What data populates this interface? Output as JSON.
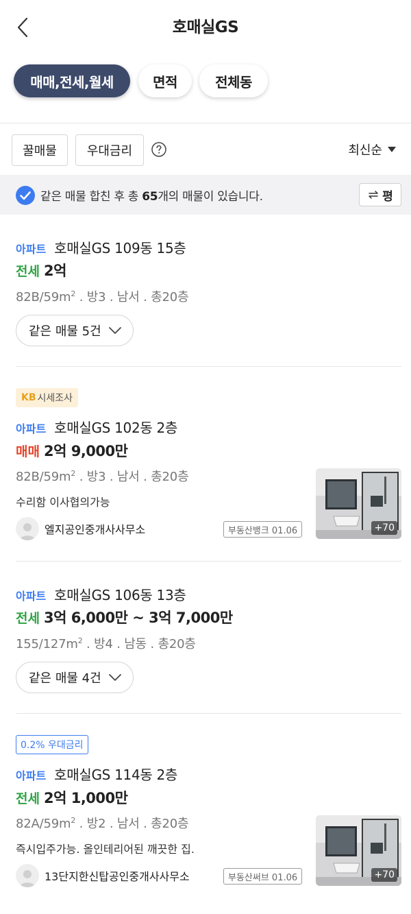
{
  "header": {
    "title": "호매실GS",
    "back_icon": "chevron-left-icon"
  },
  "filters": [
    {
      "label": "매매,전세,월세",
      "active": true
    },
    {
      "label": "면적",
      "active": false
    },
    {
      "label": "전체동",
      "active": false
    }
  ],
  "sortbar": {
    "tags": [
      "꿀매물",
      "우대금리"
    ],
    "help_icon": "question-circle-icon",
    "sort_label": "최신순"
  },
  "notice": {
    "prefix": "같은 매물 합친 후 총 ",
    "count": "65",
    "suffix": "개의 매물이 있습니다.",
    "unit_toggle": "평"
  },
  "listings": [
    {
      "badge": null,
      "type": "아파트",
      "complex": "호매실GS 109동 15층",
      "deal": "전세",
      "price": "2억",
      "area": "82B/59m",
      "area_sup": "2",
      "spec_rest": " . 방3 . 남서 . 총20층",
      "desc": null,
      "agent": null,
      "source": null,
      "photo_count": null,
      "same_label": "같은 매물 5건"
    },
    {
      "badge": {
        "kind": "kb",
        "kb": "KB",
        "text": "시세조사"
      },
      "type": "아파트",
      "complex": "호매실GS 102동 2층",
      "deal": "매매",
      "price": "2억 9,000만",
      "area": "82B/59m",
      "area_sup": "2",
      "spec_rest": " . 방3 . 남서 . 총20층",
      "desc": "수리함 이사협의가능",
      "agent": "엘지공인중개사사무소",
      "source": "부동산뱅크 01.06",
      "photo_count": "+70",
      "same_label": null
    },
    {
      "badge": null,
      "type": "아파트",
      "complex": "호매실GS 106동 13층",
      "deal": "전세",
      "price": "3억 6,000만 ~ 3억 7,000만",
      "area": "155/127m",
      "area_sup": "2",
      "spec_rest": " . 방4 . 남동 . 총20층",
      "desc": null,
      "agent": null,
      "source": null,
      "photo_count": null,
      "same_label": "같은 매물 4건"
    },
    {
      "badge": {
        "kind": "rate",
        "text": "0.2% 우대금리"
      },
      "type": "아파트",
      "complex": "호매실GS 114동 2층",
      "deal": "전세",
      "price": "2억 1,000만",
      "area": "82A/59m",
      "area_sup": "2",
      "spec_rest": " . 방2 . 남서 . 총20층",
      "desc": "즉시입주가능. 올인테리어된 깨끗한 집.",
      "agent": "13단지한신탑공인중개사사무소",
      "source": "부동산써브 01.06",
      "photo_count": "+70",
      "same_label": null
    }
  ],
  "colors": {
    "active_chip": "#3d4a6a",
    "type_blue": "#3d7cf0",
    "jeonse_green": "#2ea343",
    "maemae_red": "#e5432a",
    "kb_badge_bg": "#fdf0d9"
  }
}
